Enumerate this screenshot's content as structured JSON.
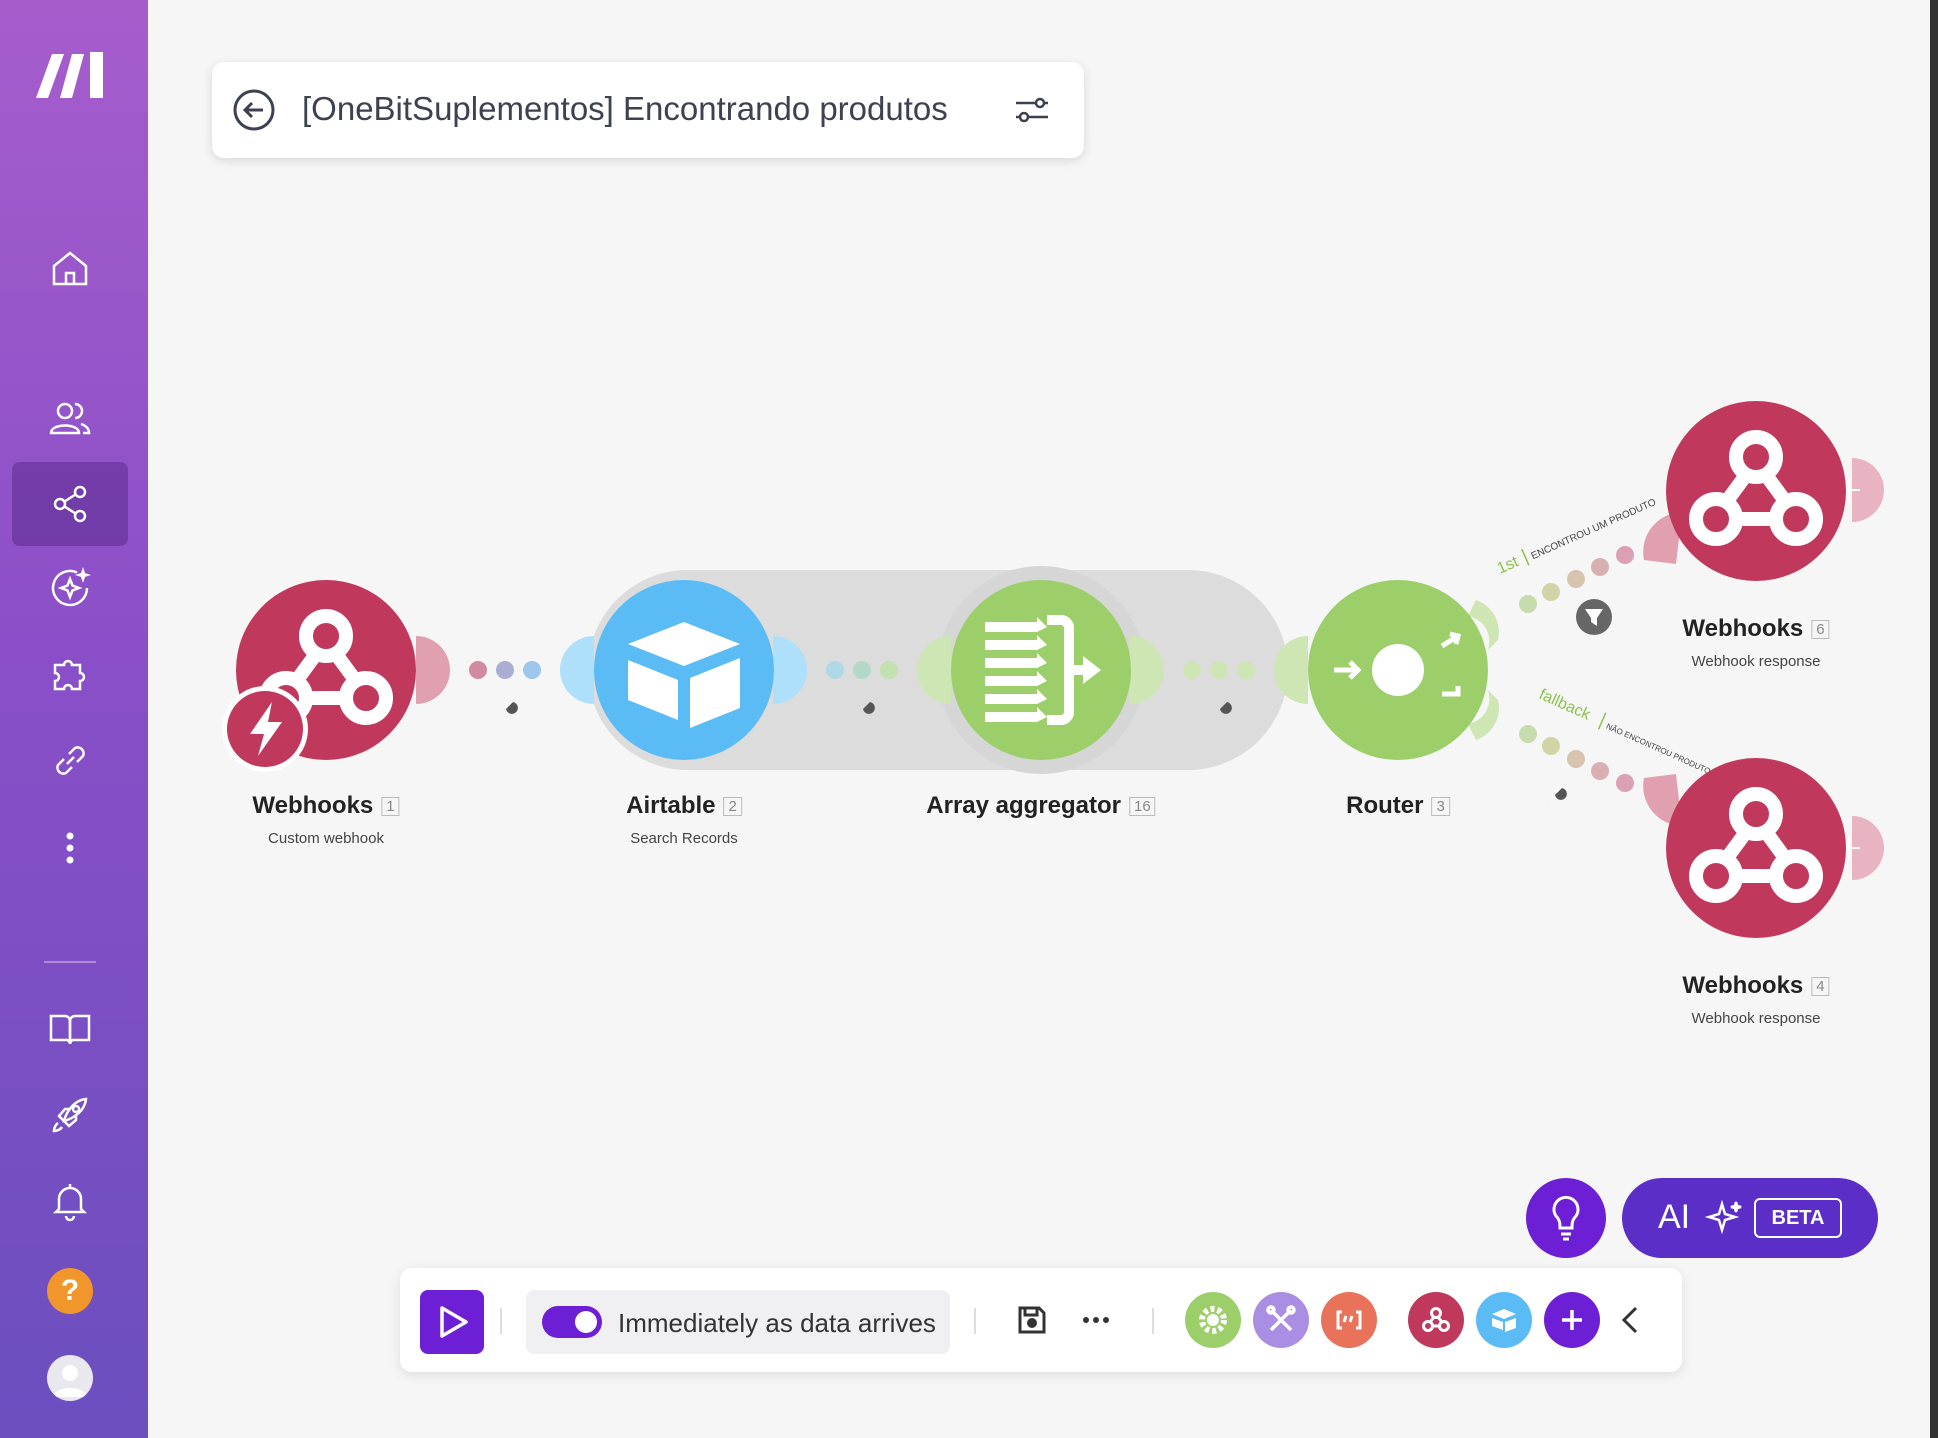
{
  "scenario": {
    "title": "[OneBitSuplementos] Encontrando produtos"
  },
  "sidebar": {
    "items": [
      {
        "name": "home",
        "icon": "home-icon"
      },
      {
        "name": "team",
        "icon": "team-icon"
      },
      {
        "name": "scenarios",
        "icon": "share-icon",
        "active": true
      },
      {
        "name": "ai-agents",
        "icon": "sparkle-circle-icon"
      },
      {
        "name": "apps",
        "icon": "puzzle-icon"
      },
      {
        "name": "connections",
        "icon": "link-icon"
      },
      {
        "name": "more",
        "icon": "more-vertical-icon"
      }
    ],
    "bottom_items": [
      {
        "name": "docs",
        "icon": "book-icon"
      },
      {
        "name": "whats-new",
        "icon": "rocket-icon"
      },
      {
        "name": "notifications",
        "icon": "bell-icon"
      }
    ],
    "help_label": "?"
  },
  "modules": {
    "webhooks1": {
      "name": "Webhooks",
      "num": "1",
      "sub": "Custom webhook",
      "color": "#c0395d"
    },
    "airtable": {
      "name": "Airtable",
      "num": "2",
      "sub": "Search Records",
      "color": "#5bbcf5"
    },
    "aggregator": {
      "name": "Array aggregator",
      "num": "16",
      "sub": "",
      "color": "#9ccf6a"
    },
    "router": {
      "name": "Router",
      "num": "3",
      "sub": "",
      "color": "#9ccf6a"
    },
    "webhooks6": {
      "name": "Webhooks",
      "num": "6",
      "sub": "Webhook response",
      "color": "#c0395d"
    },
    "webhooks4": {
      "name": "Webhooks",
      "num": "4",
      "sub": "Webhook response",
      "color": "#c0395d"
    }
  },
  "routes": {
    "first": {
      "order": "1st",
      "label": "ENCONTROU UM PRODUTO"
    },
    "fallback": {
      "order": "fallback",
      "label": "NÃO ENCONTROU PRODUTO"
    }
  },
  "toolbar": {
    "schedule_label": "Immediately as data arrives",
    "schedule_on": true,
    "tools": [
      {
        "icon": "gear-icon",
        "color": "#9ccf6a"
      },
      {
        "icon": "tools-icon",
        "color": "#a98ee3"
      },
      {
        "icon": "text-parser-icon",
        "color": "#e8735a"
      },
      {
        "icon": "webhook-icon",
        "color": "#c0395d"
      },
      {
        "icon": "airtable-icon",
        "color": "#5bbcf5"
      },
      {
        "icon": "plus-icon",
        "color": "#6d1fd6"
      }
    ]
  },
  "ai_button": {
    "label": "AI",
    "badge": "BETA"
  }
}
